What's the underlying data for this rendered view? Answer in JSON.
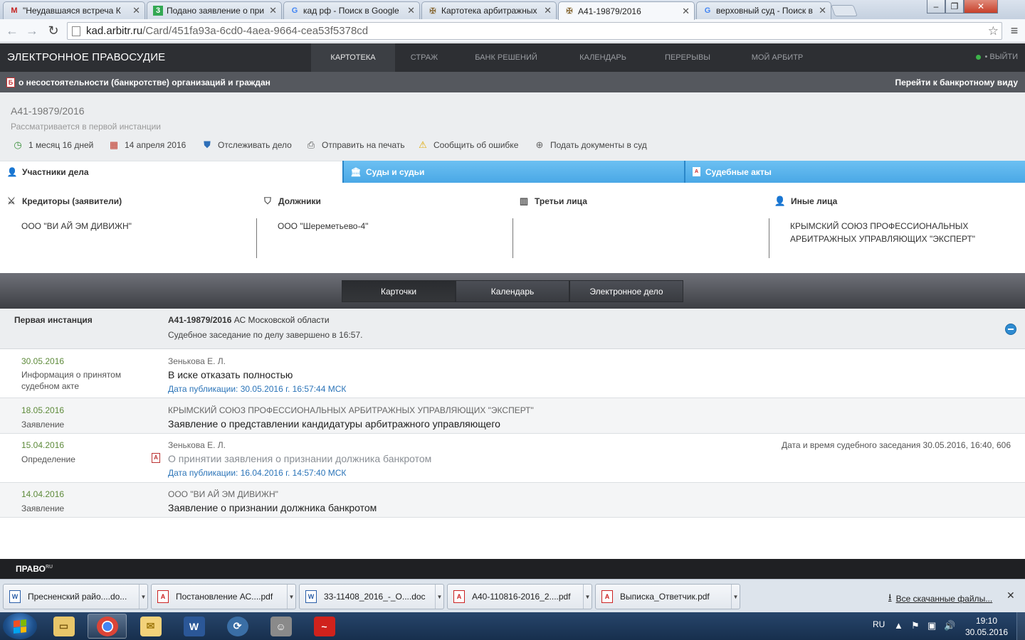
{
  "browser": {
    "tabs": [
      {
        "title": "\"Неудавшаяся встреча К",
        "icon": "gmail-icon",
        "glyph": "M",
        "color": "#c5221f"
      },
      {
        "title": "Подано заявление о при",
        "icon": "sheet-icon",
        "glyph": "3",
        "color": "#33a853"
      },
      {
        "title": "кад рф - Поиск в Google",
        "icon": "google-icon",
        "glyph": "G",
        "color": "#4285f4"
      },
      {
        "title": "Картотека арбитражных",
        "icon": "emblem-icon",
        "glyph": "✠",
        "color": "#8a6d3b"
      },
      {
        "title": "А41-19879/2016",
        "icon": "emblem-icon",
        "glyph": "✠",
        "color": "#8a6d3b"
      },
      {
        "title": "верховный суд - Поиск в",
        "icon": "google-icon",
        "glyph": "G",
        "color": "#4285f4"
      }
    ],
    "url_host": "kad.arbitr.ru",
    "url_path": "/Card/451fa93a-6cd0-4aea-9664-cea53f5378cd"
  },
  "site": {
    "logo": "ЭЛЕКТРОННОЕ ПРАВОСУДИЕ",
    "nav": [
      "КАРТОТЕКА",
      "СТРАЖ",
      "БАНК РЕШЕНИЙ",
      "КАЛЕНДАРЬ",
      "ПЕРЕРЫВЫ",
      "МОЙ АРБИТР"
    ],
    "logout": "ВЫЙТИ"
  },
  "category": {
    "label": "о несостоятельности (банкротстве) организаций и граждан",
    "switch_view": "Перейти к банкротному виду"
  },
  "case": {
    "number": "А41-19879/2016",
    "status": "Рассматривается в первой инстанции",
    "actions": [
      {
        "label": "1 месяц 16 дней",
        "icon": "clock-icon"
      },
      {
        "label": "14 апреля 2016",
        "icon": "calendar-icon"
      },
      {
        "label": "Отслеживать дело",
        "icon": "shield-icon"
      },
      {
        "label": "Отправить на печать",
        "icon": "printer-icon"
      },
      {
        "label": "Сообщить об ошибке",
        "icon": "warning-icon"
      },
      {
        "label": "Подать документы в суд",
        "icon": "plus-circle-icon"
      }
    ]
  },
  "section_tabs": [
    "Участники дела",
    "Суды и судьи",
    "Судебные акты"
  ],
  "participants": [
    {
      "heading": "Кредиторы (заявители)",
      "icon": "swords-icon",
      "value": "ООО \"ВИ АЙ ЭМ ДИВИЖН\""
    },
    {
      "heading": "Должники",
      "icon": "shield-icon",
      "value": "ООО \"Шереметьево-4\""
    },
    {
      "heading": "Третьи лица",
      "icon": "group-icon",
      "value": ""
    },
    {
      "heading": "Иные лица",
      "icon": "person-icon",
      "value": "КРЫМСКИЙ СОЮЗ ПРОФЕССИОНАЛЬНЫХ АРБИТРАЖНЫХ УПРАВЛЯЮЩИХ \"ЭКСПЕРТ\""
    }
  ],
  "view_buttons": [
    "Карточки",
    "Календарь",
    "Электронное дело"
  ],
  "instance": {
    "label": "Первая инстанция",
    "case_no": "А41-19879/2016",
    "court": "АС Московской области",
    "note": "Судебное заседание по делу завершено в 16:57."
  },
  "entries": [
    {
      "date": "30.05.2016",
      "type": "Информация о принятом судебном акте",
      "who": "Зенькова Е. Л.",
      "main": "В иске отказать полностью",
      "pub": "Дата публикации: 30.05.2016 г. 16:57:44 МСК",
      "right": ""
    },
    {
      "date": "18.05.2016",
      "type": "Заявление",
      "who": "КРЫМСКИЙ СОЮЗ ПРОФЕССИОНАЛЬНЫХ АРБИТРАЖНЫХ УПРАВЛЯЮЩИХ \"ЭКСПЕРТ\"",
      "main": "Заявление о представлении кандидатуры арбитражного управляющего",
      "pub": "",
      "right": ""
    },
    {
      "date": "15.04.2016",
      "type": "Определение",
      "who": "Зенькова Е. Л.",
      "main": "О принятии заявления о признании должника банкротом",
      "pub": "Дата публикации: 16.04.2016 г. 14:57:40 МСК",
      "right": "Дата и время судебного заседания 30.05.2016, 16:40, 606"
    },
    {
      "date": "14.04.2016",
      "type": "Заявление",
      "who": "ООО \"ВИ АЙ ЭМ ДИВИЖН\"",
      "main": "Заявление о признании должника банкротом",
      "pub": "",
      "right": ""
    }
  ],
  "footer": {
    "brand": "ПРАВО",
    "brand_sup": "RU"
  },
  "downloads": [
    {
      "name": "Пресненский райо....do...",
      "kind": "W"
    },
    {
      "name": "Постановление АС....pdf",
      "kind": "PDF"
    },
    {
      "name": "33-11408_2016_-_О....doc",
      "kind": "W"
    },
    {
      "name": "А40-110816-2016_2....pdf",
      "kind": "PDF"
    },
    {
      "name": "Выписка_Ответчик.pdf",
      "kind": "PDF"
    }
  ],
  "all_downloads": "Все скачанные файлы...",
  "taskbar": {
    "lang": "RU",
    "time": "19:10",
    "date": "30.05.2016"
  }
}
